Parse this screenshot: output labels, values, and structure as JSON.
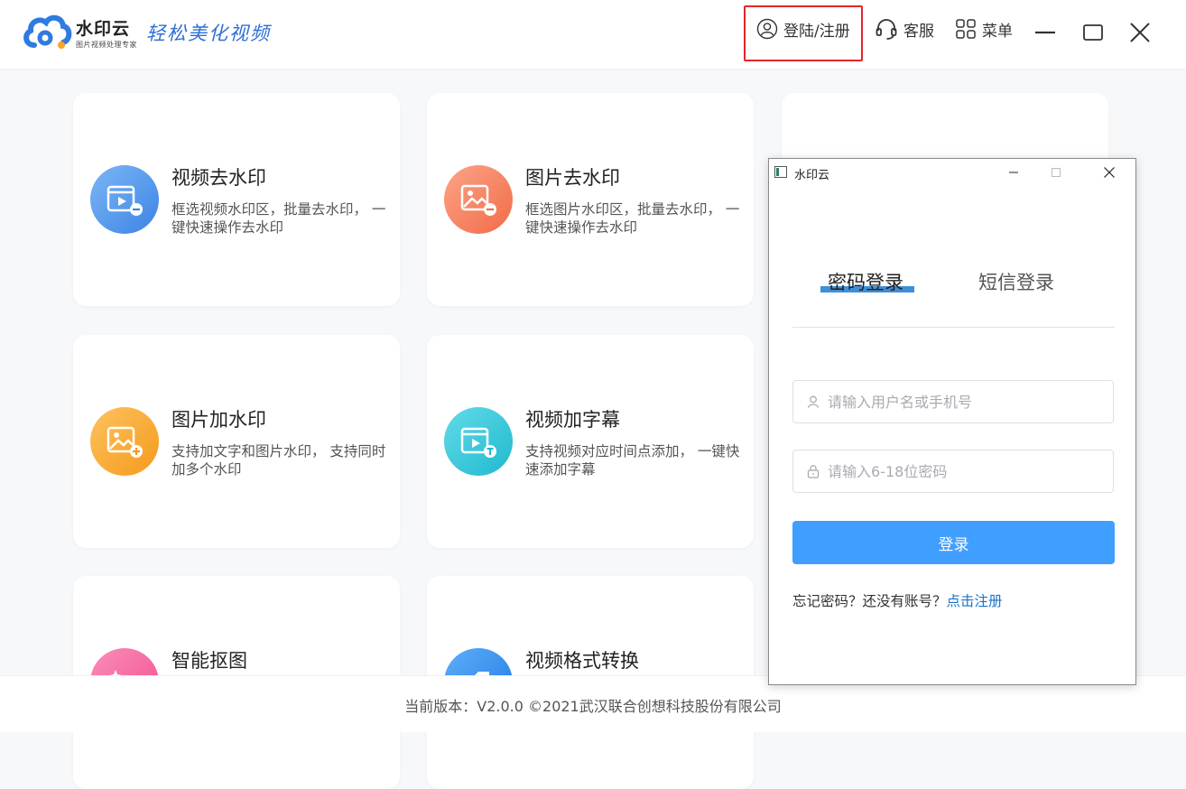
{
  "app": {
    "title": "水印云",
    "subtitle": "图片视频处理专家",
    "slogan": "轻松美化视频"
  },
  "topbar": {
    "login_label": "登陆/注册",
    "service_label": "客服",
    "menu_label": "菜单"
  },
  "cards": [
    {
      "title": "视频去水印",
      "desc": "框选视频水印区，批量去水印， 一键快速操作去水印",
      "icon": "video-remove-watermark-icon",
      "color": "#4a90e8"
    },
    {
      "title": "图片去水印",
      "desc": "框选图片水印区，批量去水印， 一键快速操作去水印",
      "icon": "image-remove-watermark-icon",
      "color": "#f47c5a"
    },
    {
      "title": "图片加水印",
      "desc": "支持加文字和图片水印， 支持同时加多个水印",
      "icon": "image-add-watermark-icon",
      "color": "#f8a436"
    },
    {
      "title": "视频加字幕",
      "desc": "支持视频对应时间点添加， 一键快速添加字幕",
      "icon": "video-subtitle-icon",
      "color": "#2fc5d8"
    },
    {
      "title": "智能抠图",
      "icon": "smart-cutout-icon",
      "color": "#f46aa0"
    },
    {
      "title": "视频格式转换",
      "icon": "video-convert-icon",
      "color": "#3a8ff0"
    }
  ],
  "footer": {
    "text": "当前版本：V2.0.0 ©2021武汉联合创想科技股份有限公司"
  },
  "dialog": {
    "title": "水印云",
    "tabs": {
      "password": "密码登录",
      "sms": "短信登录"
    },
    "username_placeholder": "请输入用户名或手机号",
    "password_placeholder": "请输入6-18位密码",
    "login_button": "登录",
    "hint": "忘记密码？还没有账号？",
    "register_link": "点击注册"
  },
  "colors": {
    "accent": "#409eff",
    "link": "#1a73c9",
    "highlight_box": "#e3262a"
  }
}
